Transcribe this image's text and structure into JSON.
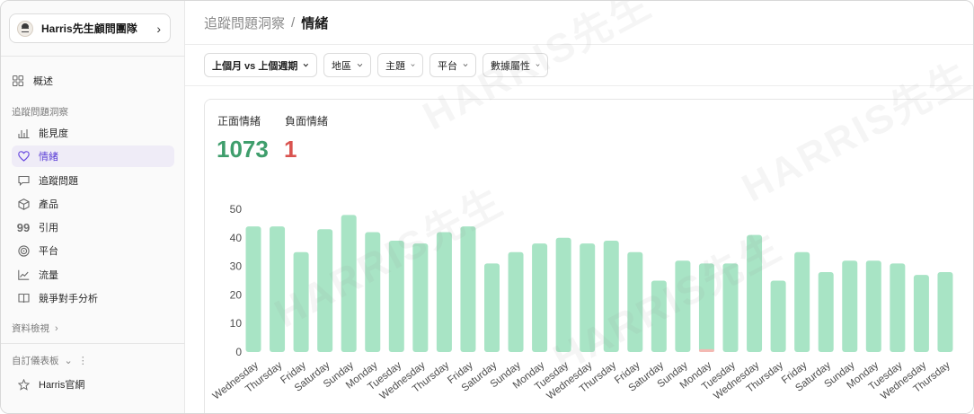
{
  "sidebar": {
    "org_name": "Harris先生顧問團隊",
    "overview_label": "概述",
    "section_tracking": "追蹤問題洞察",
    "items": [
      {
        "label": "能見度",
        "icon": "bar-chart-icon"
      },
      {
        "label": "情緒",
        "icon": "heart-icon"
      },
      {
        "label": "追蹤問題",
        "icon": "chat-bubble-icon"
      },
      {
        "label": "產品",
        "icon": "box-icon"
      },
      {
        "label": "引用",
        "icon": "quote-icon"
      },
      {
        "label": "平台",
        "icon": "target-icon"
      },
      {
        "label": "流量",
        "icon": "trend-icon"
      },
      {
        "label": "競爭對手分析",
        "icon": "book-icon"
      }
    ],
    "active_item": "情緒",
    "data_view_label": "資料檢視",
    "custom_dashboard_label": "自訂儀表板",
    "custom_item_label": "Harris官網"
  },
  "header": {
    "breadcrumb_parent": "追蹤問題洞察",
    "breadcrumb_sep": "/",
    "breadcrumb_current": "情緒"
  },
  "filters": {
    "period": "上個月 vs 上個週期",
    "region": "地區",
    "topic": "主題",
    "platform": "平台",
    "data_attr": "數據屬性"
  },
  "stats": {
    "positive_label": "正面情緒",
    "negative_label": "負面情緒",
    "positive_value": "1073",
    "negative_value": "1"
  },
  "watermark": "HARRIS先生",
  "colors": {
    "positive": "#3f9e6c",
    "negative": "#d9534f",
    "bar_positive": "#a8e4c5",
    "bar_negative": "#f4b9b3",
    "accent": "#5b3fd6"
  },
  "chart_data": {
    "type": "bar",
    "ylim": [
      0,
      50
    ],
    "yticks": [
      0,
      10,
      20,
      30,
      40,
      50
    ],
    "categories": [
      "Wednesday",
      "Thursday",
      "Friday",
      "Saturday",
      "Sunday",
      "Monday",
      "Tuesday",
      "Wednesday",
      "Thursday",
      "Friday",
      "Saturday",
      "Sunday",
      "Monday",
      "Tuesday",
      "Wednesday",
      "Thursday",
      "Friday",
      "Saturday",
      "Sunday",
      "Monday",
      "Tuesday",
      "Wednesday",
      "Thursday",
      "Friday",
      "Saturday",
      "Sunday",
      "Monday",
      "Tuesday",
      "Wednesday",
      "Thursday"
    ],
    "series": [
      {
        "values": [
          44,
          44,
          35,
          43,
          48,
          42,
          39,
          38,
          42,
          44,
          31,
          35,
          38,
          40,
          38,
          39,
          35,
          25,
          32,
          31,
          31,
          41,
          25,
          35,
          28,
          32,
          32,
          31,
          27,
          28
        ]
      },
      {
        "values": [
          0,
          0,
          0,
          0,
          0,
          0,
          0,
          0,
          0,
          0,
          0,
          0,
          0,
          0,
          0,
          0,
          0,
          0,
          0,
          1,
          0,
          0,
          0,
          0,
          0,
          0,
          0,
          0,
          0,
          0
        ]
      }
    ],
    "grid": false
  }
}
